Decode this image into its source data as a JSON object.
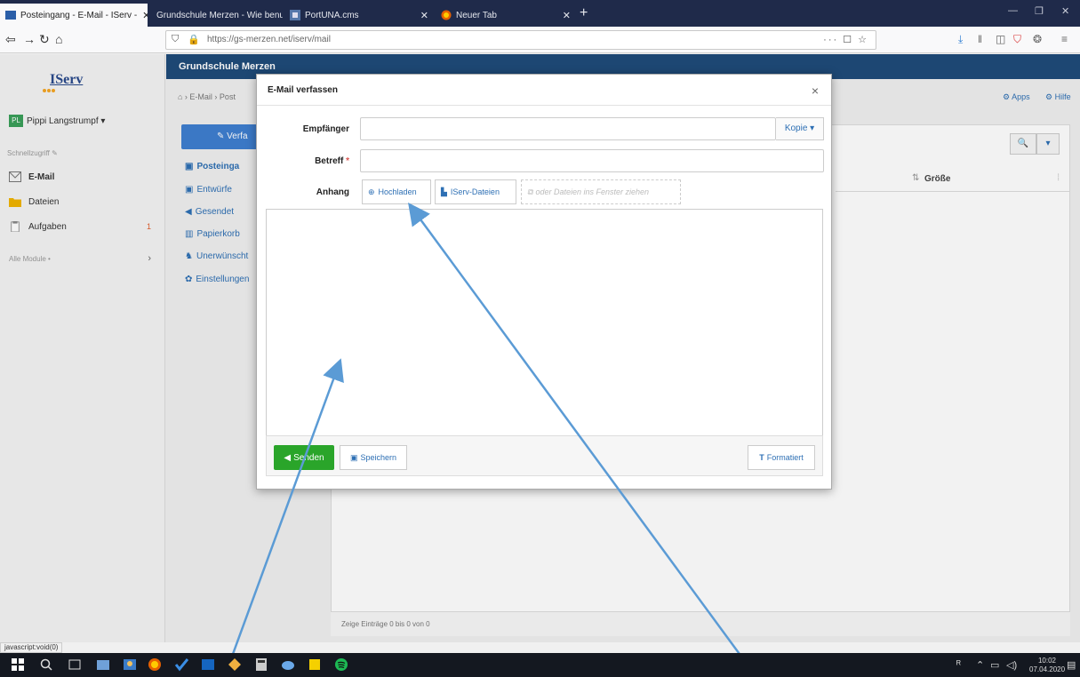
{
  "browser": {
    "tabs": [
      {
        "label": "Posteingang - E-Mail - IServ - ",
        "close": "✕"
      },
      {
        "label": "Grundschule Merzen - Wie benutze",
        "close": "✕"
      },
      {
        "label": "PortUNA.cms",
        "close": "✕"
      },
      {
        "label": "Neuer Tab",
        "close": "✕"
      }
    ],
    "new_tab": "+",
    "url": "https://gs-merzen.net/iserv/mail",
    "url_actions": "··· ☐ ☆"
  },
  "sidebar": {
    "logo": "IServ",
    "user": {
      "initials": "PL",
      "name": "Pippi Langstrumpf ▾"
    },
    "favorites_label": "Schnellzugriff  ✎",
    "items": [
      {
        "label": "E-Mail"
      },
      {
        "label": "Dateien"
      },
      {
        "label": "Aufgaben",
        "badge": "1"
      }
    ],
    "all_modules": "Alle Module  •",
    "all_modules_chevron": "›"
  },
  "app": {
    "school": "Grundschule Merzen",
    "breadcrumb": "⌂ › E-Mail › Post",
    "apps_link": "⚙ Apps",
    "help_link": "⚙ Hilfe"
  },
  "folders": {
    "compose": "✎ Verfa",
    "items": [
      {
        "icon": "▣",
        "label": "Posteinga"
      },
      {
        "icon": "▣",
        "label": "Entwürfe"
      },
      {
        "icon": "◀",
        "label": "Gesendet"
      },
      {
        "icon": "▥",
        "label": "Papierkorb"
      },
      {
        "icon": "♞",
        "label": "Unerwünscht"
      },
      {
        "icon": "✿",
        "label": "Einstellungen"
      }
    ]
  },
  "maillist": {
    "size_column": "Größe",
    "sort_icon": "⇅",
    "col_drag": "⁞",
    "search_icon": "🔍",
    "search_dropdown": "▾",
    "footer": "Zeige Einträge 0 bis 0 von 0"
  },
  "compose": {
    "title": "E-Mail verfassen",
    "close": "×",
    "recipient_label": "Empfänger",
    "recipient_value": "",
    "copy_button": "Kopie ▾",
    "subject_label": "Betreff",
    "subject_required": "*",
    "subject_value": "",
    "attachment_label": "Anhang",
    "upload_button": "Hochladen",
    "iserv_files_button": "IServ-Dateien",
    "drop_zone": "oder Dateien ins Fenster ziehen",
    "body_value": "",
    "send_button": "Senden",
    "save_button": "Speichern",
    "format_button": "Formatiert"
  },
  "status": {
    "link": "javascript:void(0)"
  },
  "taskbar": {
    "clock_time": "10:02",
    "clock_date": "07.04.2020"
  },
  "colors": {
    "header_blue": "#1f4b7a",
    "compose_blue": "#3f7fd0",
    "send_green": "#2aa52a",
    "link_blue": "#2d6fb4",
    "arrow": "#5b9bd5"
  }
}
